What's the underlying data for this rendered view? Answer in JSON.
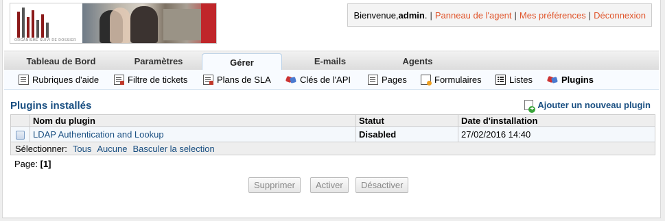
{
  "header": {
    "logo_caption": "ORGANISME SUIVI DE DOSSIER",
    "welcome_prefix": "Bienvenue, ",
    "username": "admin",
    "welcome_suffix": ".",
    "links": [
      "Panneau de l'agent",
      "Mes préférences",
      "Déconnexion"
    ]
  },
  "tabs": [
    "Tableau de Bord",
    "Paramètres",
    "Gérer",
    "E-mails",
    "Agents"
  ],
  "active_tab": "Gérer",
  "subnav": [
    "Rubriques d'aide",
    "Filtre de tickets",
    "Plans de SLA",
    "Clés de l'API",
    "Pages",
    "Formulaires",
    "Listes",
    "Plugins"
  ],
  "subnav_icons": [
    "help-topics-icon",
    "ticket-filter-icon",
    "sla-plans-icon",
    "api-keys-icon",
    "pages-icon",
    "forms-icon",
    "lists-icon",
    "plugins-icon"
  ],
  "active_subnav": "Plugins",
  "main": {
    "title": "Plugins installés",
    "add_label": "Ajouter un nouveau plugin",
    "columns": [
      "Nom du plugin",
      "Statut",
      "Date d'installation"
    ],
    "rows": [
      {
        "name": "LDAP Authentication and Lookup",
        "status": "Disabled",
        "date": "27/02/2016 14:40"
      }
    ],
    "select_label": "Sélectionner:",
    "select_links": [
      "Tous",
      "Aucune",
      "Basculer la selection"
    ],
    "page_label": "Page:",
    "page_current": "[1]",
    "buttons": [
      "Supprimer",
      "Activer",
      "Désactiver"
    ]
  },
  "colors": {
    "accent": "#184e81",
    "link": "#e0542a"
  }
}
